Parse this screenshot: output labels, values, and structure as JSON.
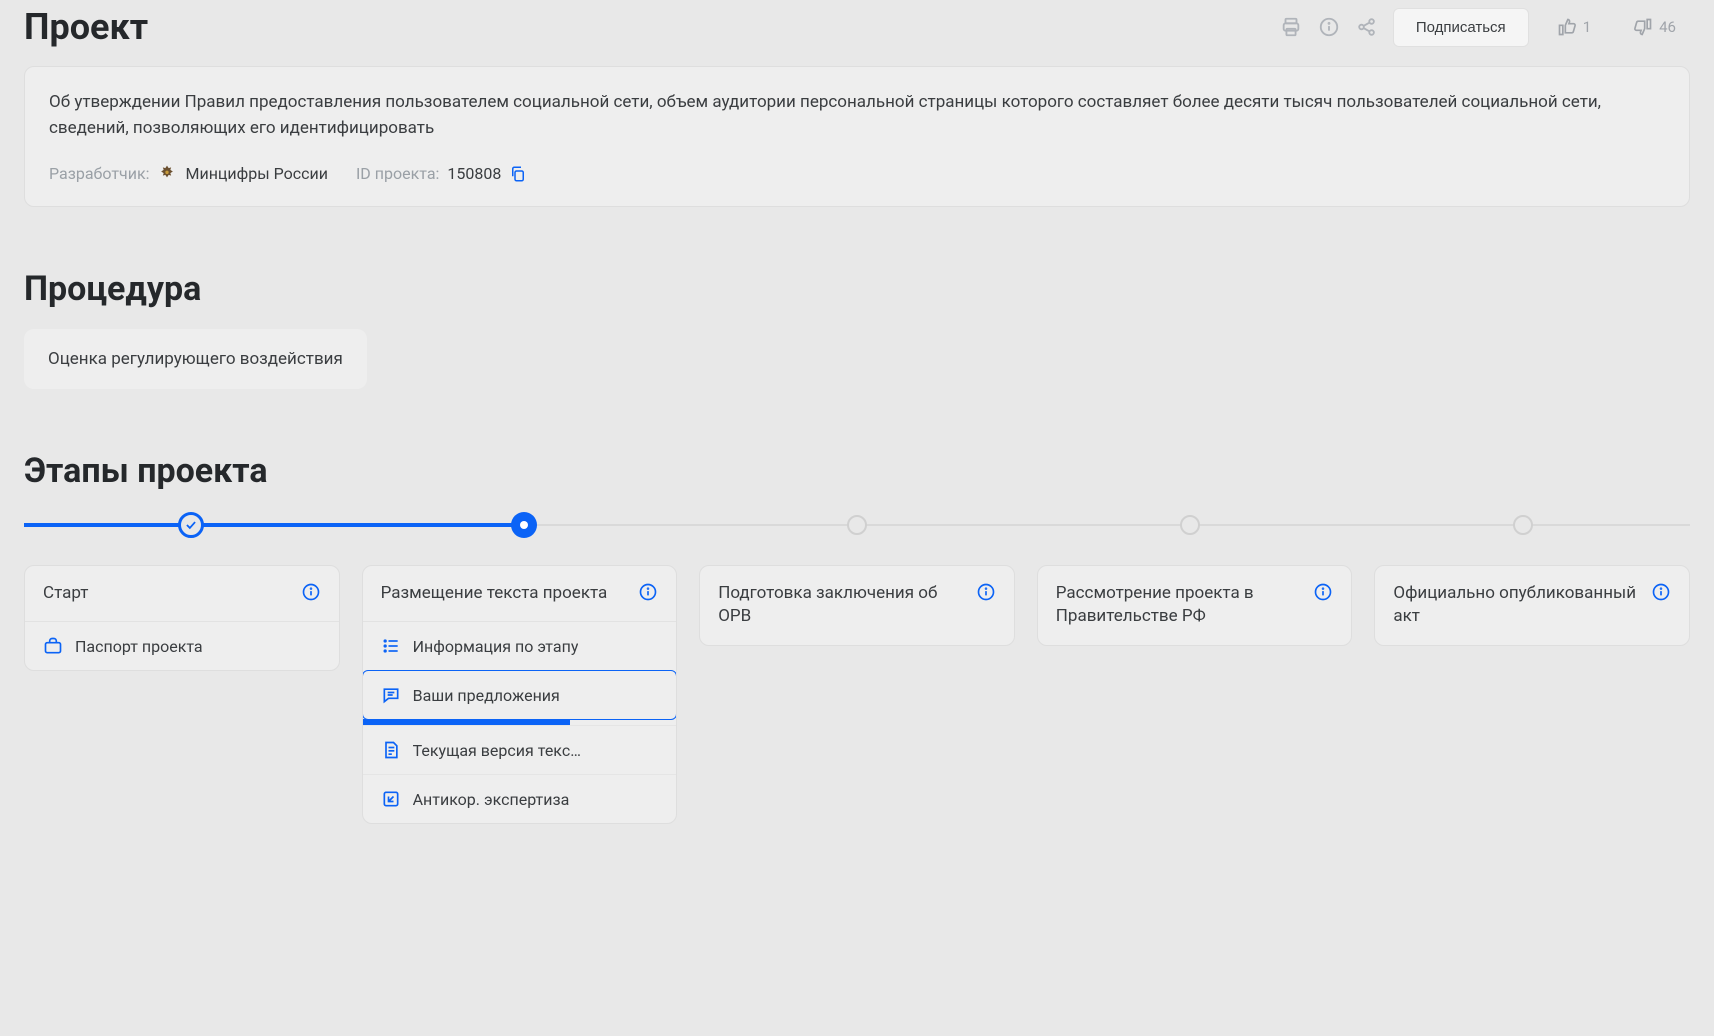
{
  "header": {
    "title": "Проект",
    "subscribe": "Подписаться",
    "likes": "1",
    "dislikes": "46"
  },
  "project": {
    "description": "Об утверждении Правил предоставления пользователем социальной сети, объем аудитории персональной страницы которого составляет более десяти тысяч пользователей социальной сети, сведений, позволяющих его идентифицировать",
    "developer_label": "Разработчик:",
    "developer_value": "Минцифры России",
    "id_label": "ID проекта:",
    "id_value": "150808"
  },
  "procedure": {
    "heading": "Процедура",
    "value": "Оценка регулирующего воздействия"
  },
  "stages": {
    "heading": "Этапы проекта",
    "items": [
      {
        "title": "Старт",
        "state": "done",
        "sub": [
          {
            "icon": "briefcase",
            "label": "Паспорт проекта"
          }
        ]
      },
      {
        "title": "Размещение текста проекта",
        "state": "current",
        "sub": [
          {
            "icon": "list",
            "label": "Информация по этапу"
          },
          {
            "icon": "chat",
            "label": "Ваши предложения",
            "selected": true
          },
          {
            "icon": "doc",
            "label": "Текущая версия текс…"
          },
          {
            "icon": "edit",
            "label": "Антикор. экспертиза"
          }
        ],
        "progress_underline": true
      },
      {
        "title": "Подготовка заключения об ОРВ",
        "state": "future"
      },
      {
        "title": "Рассмотрение проекта в Правительстве РФ",
        "state": "future"
      },
      {
        "title": "Официально опубликованный акт",
        "state": "future"
      }
    ]
  }
}
